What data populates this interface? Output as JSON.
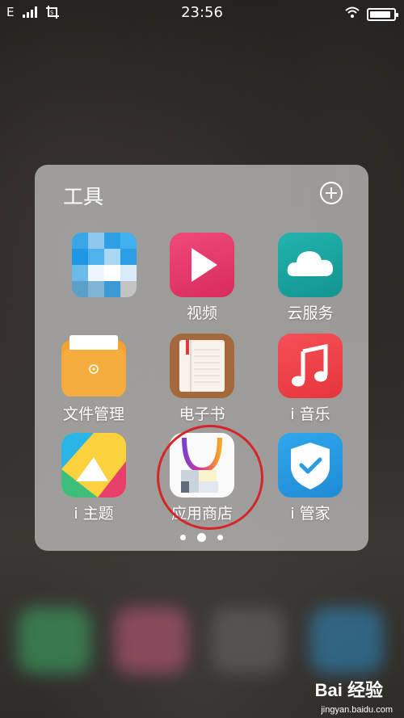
{
  "status_bar": {
    "carrier": "E",
    "time": "23:56",
    "battery_level": 0.9
  },
  "folder": {
    "title": "工具",
    "page_count": 3,
    "active_page": 2,
    "apps": [
      {
        "label": "",
        "icon": "pixelated-icon"
      },
      {
        "label": "视频",
        "icon": "play-icon",
        "color": "#e8366b"
      },
      {
        "label": "云服务",
        "icon": "cloud-icon",
        "color": "#1ba3a0"
      },
      {
        "label": "文件管理",
        "icon": "folder-icon",
        "color": "#f29b2b"
      },
      {
        "label": "电子书",
        "icon": "book-icon",
        "color": "#a86b3e"
      },
      {
        "label": "i 音乐",
        "icon": "music-note-icon",
        "color": "#f0424a"
      },
      {
        "label": "i 主题",
        "icon": "theme-icon",
        "color": "#3dbf7a"
      },
      {
        "label": "应用商店",
        "icon": "shopping-bag-icon",
        "color": "#ffffff"
      },
      {
        "label": "i 管家",
        "icon": "shield-check-icon",
        "color": "#2a9ae3"
      }
    ]
  },
  "watermark": {
    "brand": "Bai 经验",
    "url": "jingyan.baidu.com"
  }
}
